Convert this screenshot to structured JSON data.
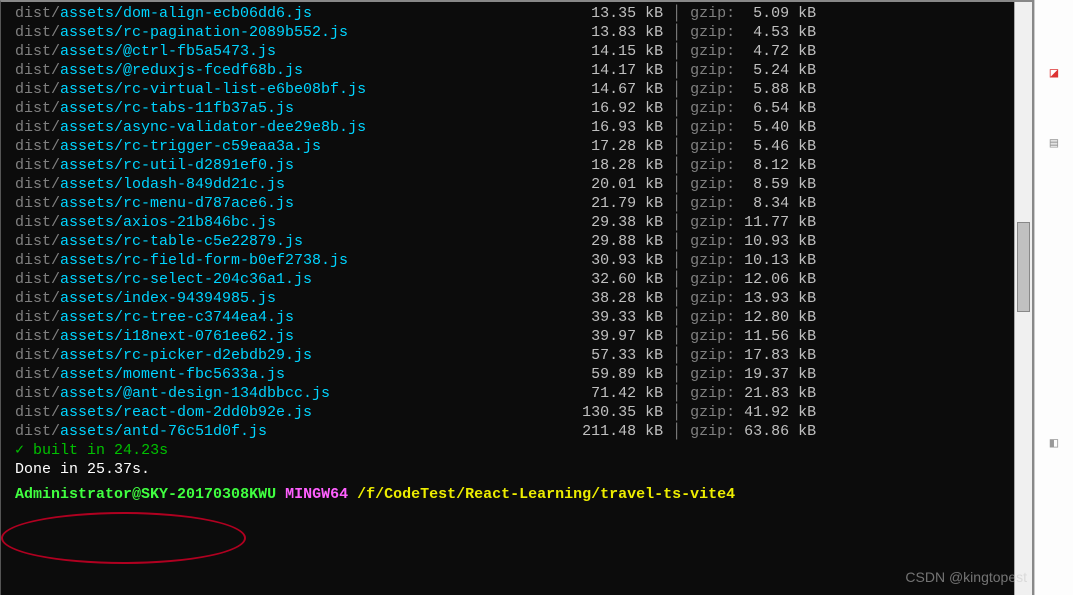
{
  "build_output": {
    "rows": [
      {
        "prefix": "dist/",
        "file": "assets/dom-align-ecb06dd6.js",
        "size": "13.35 kB",
        "gzlabel": "gzip:",
        "gzip": "5.09 kB"
      },
      {
        "prefix": "dist/",
        "file": "assets/rc-pagination-2089b552.js",
        "size": "13.83 kB",
        "gzlabel": "gzip:",
        "gzip": "4.53 kB"
      },
      {
        "prefix": "dist/",
        "file": "assets/@ctrl-fb5a5473.js",
        "size": "14.15 kB",
        "gzlabel": "gzip:",
        "gzip": "4.72 kB"
      },
      {
        "prefix": "dist/",
        "file": "assets/@reduxjs-fcedf68b.js",
        "size": "14.17 kB",
        "gzlabel": "gzip:",
        "gzip": "5.24 kB"
      },
      {
        "prefix": "dist/",
        "file": "assets/rc-virtual-list-e6be08bf.js",
        "size": "14.67 kB",
        "gzlabel": "gzip:",
        "gzip": "5.88 kB"
      },
      {
        "prefix": "dist/",
        "file": "assets/rc-tabs-11fb37a5.js",
        "size": "16.92 kB",
        "gzlabel": "gzip:",
        "gzip": "6.54 kB"
      },
      {
        "prefix": "dist/",
        "file": "assets/async-validator-dee29e8b.js",
        "size": "16.93 kB",
        "gzlabel": "gzip:",
        "gzip": "5.40 kB"
      },
      {
        "prefix": "dist/",
        "file": "assets/rc-trigger-c59eaa3a.js",
        "size": "17.28 kB",
        "gzlabel": "gzip:",
        "gzip": "5.46 kB"
      },
      {
        "prefix": "dist/",
        "file": "assets/rc-util-d2891ef0.js",
        "size": "18.28 kB",
        "gzlabel": "gzip:",
        "gzip": "8.12 kB"
      },
      {
        "prefix": "dist/",
        "file": "assets/lodash-849dd21c.js",
        "size": "20.01 kB",
        "gzlabel": "gzip:",
        "gzip": "8.59 kB"
      },
      {
        "prefix": "dist/",
        "file": "assets/rc-menu-d787ace6.js",
        "size": "21.79 kB",
        "gzlabel": "gzip:",
        "gzip": "8.34 kB"
      },
      {
        "prefix": "dist/",
        "file": "assets/axios-21b846bc.js",
        "size": "29.38 kB",
        "gzlabel": "gzip:",
        "gzip": "11.77 kB"
      },
      {
        "prefix": "dist/",
        "file": "assets/rc-table-c5e22879.js",
        "size": "29.88 kB",
        "gzlabel": "gzip:",
        "gzip": "10.93 kB"
      },
      {
        "prefix": "dist/",
        "file": "assets/rc-field-form-b0ef2738.js",
        "size": "30.93 kB",
        "gzlabel": "gzip:",
        "gzip": "10.13 kB"
      },
      {
        "prefix": "dist/",
        "file": "assets/rc-select-204c36a1.js",
        "size": "32.60 kB",
        "gzlabel": "gzip:",
        "gzip": "12.06 kB"
      },
      {
        "prefix": "dist/",
        "file": "assets/index-94394985.js",
        "size": "38.28 kB",
        "gzlabel": "gzip:",
        "gzip": "13.93 kB"
      },
      {
        "prefix": "dist/",
        "file": "assets/rc-tree-c3744ea4.js",
        "size": "39.33 kB",
        "gzlabel": "gzip:",
        "gzip": "12.80 kB"
      },
      {
        "prefix": "dist/",
        "file": "assets/i18next-0761ee62.js",
        "size": "39.97 kB",
        "gzlabel": "gzip:",
        "gzip": "11.56 kB"
      },
      {
        "prefix": "dist/",
        "file": "assets/rc-picker-d2ebdb29.js",
        "size": "57.33 kB",
        "gzlabel": "gzip:",
        "gzip": "17.83 kB"
      },
      {
        "prefix": "dist/",
        "file": "assets/moment-fbc5633a.js",
        "size": "59.89 kB",
        "gzlabel": "gzip:",
        "gzip": "19.37 kB"
      },
      {
        "prefix": "dist/",
        "file": "assets/@ant-design-134dbbcc.js",
        "size": "71.42 kB",
        "gzlabel": "gzip:",
        "gzip": "21.83 kB"
      },
      {
        "prefix": "dist/",
        "file": "assets/react-dom-2dd0b92e.js",
        "size": "130.35 kB",
        "gzlabel": "gzip:",
        "gzip": "41.92 kB"
      },
      {
        "prefix": "dist/",
        "file": "assets/antd-76c51d0f.js",
        "size": "211.48 kB",
        "gzlabel": "gzip:",
        "gzip": "63.86 kB"
      }
    ],
    "built_line_prefix": "✓ ",
    "built_line": "built in 24.23s",
    "done_line": "Done in 25.37s."
  },
  "prompt": {
    "user": "Administrator",
    "at": "@",
    "host": "SKY-20170308KWU",
    "space": " ",
    "mingw": "MINGW64",
    "space2": " ",
    "path": "/f/CodeTest/React-Learning/travel-ts-vite4"
  },
  "gutter_markers": [
    "]",
    "]",
    "]",
    "]",
    "]",
    "]",
    "]"
  ],
  "watermark": "CSDN @kingtopest"
}
